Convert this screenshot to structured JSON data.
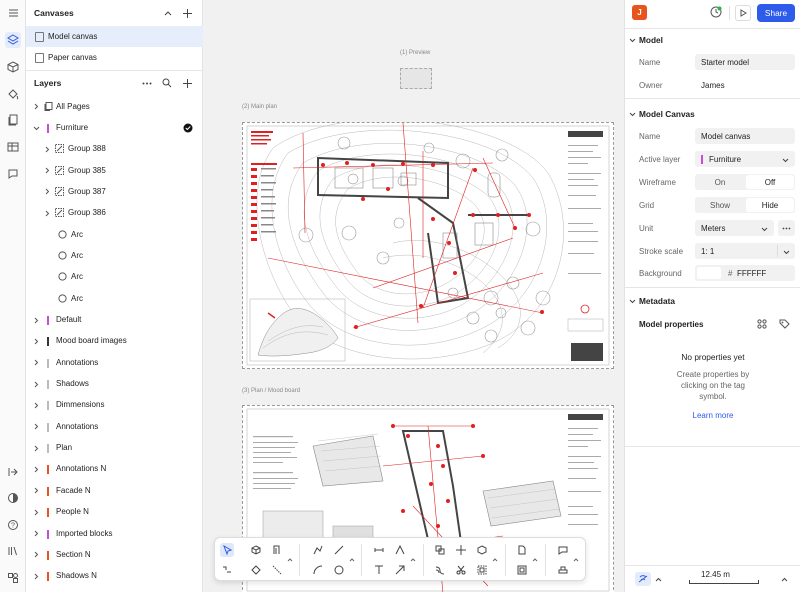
{
  "canvases": {
    "title": "Canvases",
    "items": [
      {
        "label": "Model canvas",
        "selected": true
      },
      {
        "label": "Paper canvas",
        "selected": false
      }
    ]
  },
  "layers": {
    "title": "Layers",
    "items": [
      {
        "label": "All Pages",
        "indent": 0,
        "kind": "pages",
        "color": ""
      },
      {
        "label": "Furniture",
        "indent": 0,
        "kind": "layer",
        "color": "#c94bd6",
        "expanded": true,
        "active": true
      },
      {
        "label": "Group 388",
        "indent": 1,
        "kind": "group",
        "color": ""
      },
      {
        "label": "Group 385",
        "indent": 1,
        "kind": "group",
        "color": ""
      },
      {
        "label": "Group 387",
        "indent": 1,
        "kind": "group",
        "color": ""
      },
      {
        "label": "Group 386",
        "indent": 1,
        "kind": "group",
        "color": ""
      },
      {
        "label": "Arc",
        "indent": 2,
        "kind": "arc",
        "color": ""
      },
      {
        "label": "Arc",
        "indent": 2,
        "kind": "arc",
        "color": ""
      },
      {
        "label": "Arc",
        "indent": 2,
        "kind": "arc",
        "color": ""
      },
      {
        "label": "Arc",
        "indent": 2,
        "kind": "arc",
        "color": ""
      },
      {
        "label": "Default",
        "indent": 0,
        "kind": "layer",
        "color": "#c94bd6"
      },
      {
        "label": "Mood board images",
        "indent": 0,
        "kind": "layer",
        "color": "#333333"
      },
      {
        "label": "Annotations",
        "indent": 0,
        "kind": "layer",
        "color": "#bbbbbb"
      },
      {
        "label": "Shadows",
        "indent": 0,
        "kind": "layer",
        "color": "#bbbbbb"
      },
      {
        "label": "Dimmensions",
        "indent": 0,
        "kind": "layer",
        "color": "#bbbbbb"
      },
      {
        "label": "Annotations",
        "indent": 0,
        "kind": "layer",
        "color": "#bbbbbb"
      },
      {
        "label": "Plan",
        "indent": 0,
        "kind": "layer",
        "color": "#bbbbbb"
      },
      {
        "label": "Annotations N",
        "indent": 0,
        "kind": "layer",
        "color": "#e8541e"
      },
      {
        "label": "Facade N",
        "indent": 0,
        "kind": "layer",
        "color": "#e8541e"
      },
      {
        "label": "People N",
        "indent": 0,
        "kind": "layer",
        "color": "#e8541e"
      },
      {
        "label": "Imported blocks",
        "indent": 0,
        "kind": "layer",
        "color": "#c94bd6"
      },
      {
        "label": "Section N",
        "indent": 0,
        "kind": "layer",
        "color": "#e8541e"
      },
      {
        "label": "Shadows N",
        "indent": 0,
        "kind": "layer",
        "color": "#e8541e"
      }
    ]
  },
  "canvas": {
    "frame1": "(1) Preview",
    "frame2": "(2) Main plan",
    "frame3": "(3) Plan / Mood board",
    "sheet_title": "HOUSE ON THE HILL"
  },
  "header": {
    "avatar": "J",
    "share_label": "Share"
  },
  "model": {
    "title": "Model",
    "name_label": "Name",
    "name_value": "Starter model",
    "owner_label": "Owner",
    "owner_value": "James"
  },
  "model_canvas": {
    "title": "Model Canvas",
    "name_label": "Name",
    "name_value": "Model canvas",
    "active_layer_label": "Active layer",
    "active_layer_value": "Furniture",
    "active_layer_color": "#c94bd6",
    "wireframe_label": "Wireframe",
    "wireframe_on": "On",
    "wireframe_off": "Off",
    "grid_label": "Grid",
    "grid_show": "Show",
    "grid_hide": "Hide",
    "unit_label": "Unit",
    "unit_value": "Meters",
    "stroke_label": "Stroke scale",
    "stroke_value": "1: 1",
    "background_label": "Background",
    "background_hash": "#",
    "background_value": "FFFFFF"
  },
  "metadata": {
    "title": "Metadata",
    "props_title": "Model properties",
    "empty_title": "No properties yet",
    "empty_text_1": "Create properties by",
    "empty_text_2": "clicking on the tag",
    "empty_text_3": "symbol.",
    "learn_more": "Learn more"
  },
  "footer": {
    "scale_value": "12.45 m"
  },
  "colors": {
    "accent": "#2f5bea",
    "avatar": "#e8541e",
    "red": "#e02020"
  }
}
